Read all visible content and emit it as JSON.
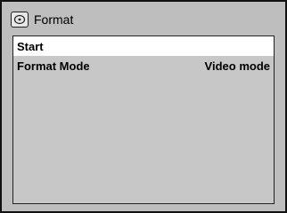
{
  "window": {
    "title": "Format",
    "icon": "disc-icon"
  },
  "menu": {
    "items": [
      {
        "label": "Start",
        "value": "",
        "selected": true
      },
      {
        "label": "Format Mode",
        "value": "Video mode",
        "selected": false
      }
    ]
  },
  "colors": {
    "background": "#cfcfcf",
    "highlight": "#ffffff",
    "text": "#000000"
  }
}
